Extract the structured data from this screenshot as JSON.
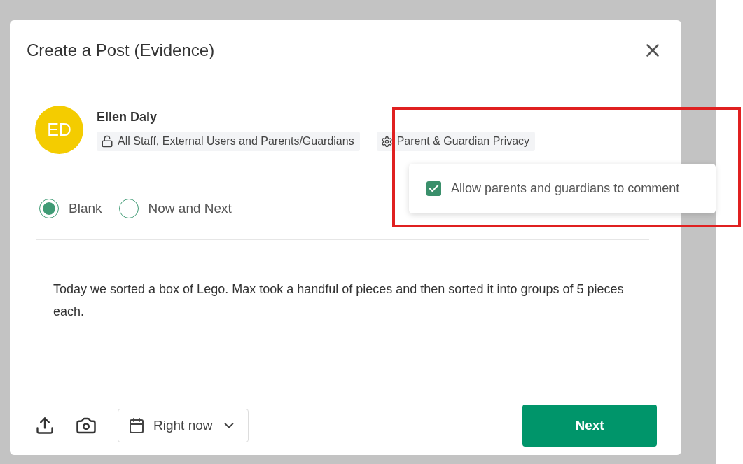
{
  "dialog": {
    "title": "Create a Post (Evidence)"
  },
  "author": {
    "initials": "ED",
    "name": "Ellen Daly",
    "audience": "All Staff, External Users and Parents/Guardians",
    "privacy_label": "Parent & Guardian Privacy"
  },
  "privacy_menu": [
    {
      "label": "Allow parents and guardians to comment",
      "checked": true
    }
  ],
  "templates": [
    {
      "label": "Blank",
      "selected": true
    },
    {
      "label": "Now and Next",
      "selected": false
    }
  ],
  "post_text": "Today we sorted a box of Lego. Max took a handful of pieces and then sorted it into groups of 5 pieces each.",
  "footer": {
    "date": "Right now",
    "next": "Next"
  }
}
